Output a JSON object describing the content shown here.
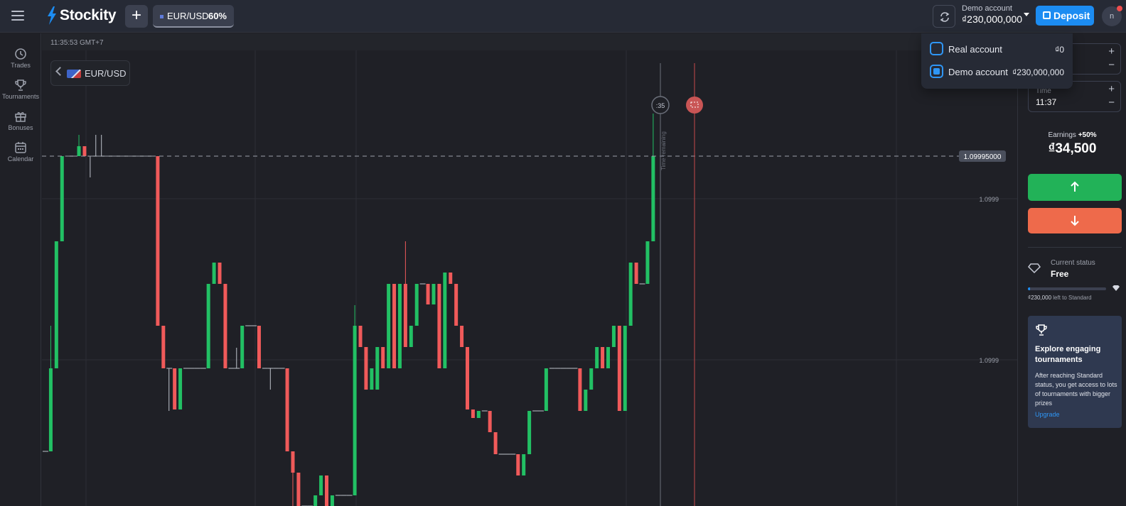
{
  "topbar": {
    "brand": "Stockity",
    "add_label": "+",
    "asset_tab": {
      "name": "EUR/USD",
      "payout": "60%"
    },
    "account": {
      "label": "Demo account",
      "balance": "₫230,000,000"
    },
    "deposit_label": "Deposit",
    "avatar_initial": "n"
  },
  "sidebar": {
    "items": [
      {
        "label": "Trades",
        "icon": "clock-icon"
      },
      {
        "label": "Tournaments",
        "icon": "trophy-icon"
      },
      {
        "label": "Bonuses",
        "icon": "gift-icon"
      },
      {
        "label": "Calendar",
        "icon": "calendar-icon"
      }
    ]
  },
  "chart": {
    "time": "11:35:53 GMT+7",
    "asset": "EUR/USD",
    "current_price": "1.09995000",
    "price_labels": [
      "1.0999",
      "1.0999"
    ],
    "countdown": ":35",
    "countdown_caption": "Time remaining",
    "colors": {
      "up": "#22c064",
      "down": "#f05a5a",
      "grid": "#2c2e35"
    }
  },
  "chart_data": {
    "type": "candlestick",
    "series": [
      {
        "name": "candles",
        "values": [
          [
            0,
            636,
            636,
            636,
            636
          ],
          [
            1,
            636,
            519,
            519,
            459
          ],
          [
            2,
            519,
            340,
            340,
            340
          ],
          [
            3,
            340,
            220,
            220,
            220
          ],
          [
            4,
            220,
            220,
            220,
            220
          ],
          [
            5,
            220,
            220,
            220,
            220
          ],
          [
            6,
            220,
            206,
            220,
            190
          ],
          [
            7,
            206,
            220,
            220,
            206
          ],
          [
            8,
            220,
            220,
            220,
            250
          ],
          [
            9,
            220,
            220,
            220,
            190
          ],
          [
            10,
            220,
            220,
            220,
            190
          ],
          [
            11,
            220,
            220,
            220,
            220
          ],
          [
            12,
            220,
            220,
            220,
            220
          ],
          [
            13,
            220,
            220,
            220,
            220
          ],
          [
            14,
            220,
            220,
            220,
            220
          ],
          [
            15,
            220,
            220,
            220,
            220
          ],
          [
            16,
            220,
            220,
            220,
            220
          ],
          [
            17,
            220,
            220,
            220,
            220
          ],
          [
            18,
            220,
            220,
            220,
            220
          ],
          [
            19,
            220,
            220,
            220,
            220
          ],
          [
            20,
            220,
            459,
            459,
            459
          ],
          [
            21,
            459,
            519,
            519,
            519
          ],
          [
            22,
            519,
            519,
            519,
            579
          ],
          [
            23,
            519,
            577,
            577,
            577
          ],
          [
            24,
            577,
            519,
            519,
            519
          ],
          [
            25,
            519,
            519,
            519,
            519
          ],
          [
            26,
            519,
            519,
            519,
            519
          ],
          [
            27,
            519,
            519,
            519,
            519
          ],
          [
            28,
            519,
            519,
            519,
            519
          ],
          [
            29,
            519,
            400,
            400,
            400
          ],
          [
            30,
            400,
            370,
            370,
            370
          ],
          [
            31,
            370,
            400,
            400,
            400
          ],
          [
            32,
            400,
            519,
            519,
            519
          ],
          [
            33,
            519,
            519,
            519,
            519
          ],
          [
            34,
            519,
            519,
            519,
            490
          ],
          [
            35,
            519,
            459,
            459,
            459
          ],
          [
            36,
            459,
            459,
            459,
            459
          ],
          [
            37,
            459,
            459,
            459,
            459
          ],
          [
            38,
            459,
            519,
            519,
            519
          ],
          [
            39,
            519,
            519,
            519,
            519
          ],
          [
            40,
            519,
            519,
            519,
            549
          ],
          [
            41,
            519,
            519,
            519,
            519
          ],
          [
            42,
            519,
            519,
            519,
            519
          ],
          [
            43,
            519,
            636,
            636,
            636
          ],
          [
            44,
            636,
            666,
            666,
            713
          ],
          [
            45,
            666,
            713,
            713,
            713
          ],
          [
            46,
            713,
            713,
            713,
            713
          ],
          [
            47,
            713,
            713,
            713,
            713
          ],
          [
            48,
            713,
            698,
            698,
            698
          ],
          [
            49,
            698,
            670,
            670,
            670
          ],
          [
            50,
            670,
            713,
            713,
            713
          ],
          [
            51,
            713,
            698,
            698,
            698
          ],
          [
            52,
            698,
            698,
            698,
            698
          ],
          [
            53,
            698,
            698,
            698,
            698
          ],
          [
            54,
            698,
            698,
            698,
            698
          ],
          [
            55,
            698,
            459,
            459,
            430
          ],
          [
            56,
            459,
            489,
            489,
            489
          ],
          [
            57,
            489,
            549,
            549,
            549
          ],
          [
            58,
            549,
            519,
            519,
            519
          ],
          [
            59,
            549,
            489,
            489,
            489
          ],
          [
            60,
            489,
            519,
            519,
            519
          ],
          [
            61,
            519,
            400,
            400,
            400
          ],
          [
            62,
            400,
            519,
            519,
            519
          ],
          [
            63,
            519,
            400,
            400,
            400
          ],
          [
            64,
            400,
            489,
            489,
            340
          ],
          [
            65,
            489,
            459,
            459,
            459
          ],
          [
            66,
            459,
            400,
            400,
            400
          ],
          [
            67,
            400,
            400,
            400,
            400
          ],
          [
            68,
            400,
            429,
            429,
            429
          ],
          [
            69,
            429,
            400,
            400,
            400
          ],
          [
            70,
            400,
            519,
            519,
            519
          ],
          [
            71,
            519,
            384,
            384,
            384
          ],
          [
            72,
            384,
            400,
            400,
            400
          ],
          [
            73,
            400,
            459,
            459,
            459
          ],
          [
            74,
            459,
            489,
            489,
            489
          ],
          [
            75,
            489,
            577,
            577,
            577
          ],
          [
            76,
            577,
            589,
            589,
            589
          ],
          [
            77,
            589,
            579,
            579,
            579
          ],
          [
            78,
            579,
            579,
            579,
            579
          ],
          [
            79,
            579,
            609,
            609,
            609
          ],
          [
            80,
            609,
            640,
            640,
            640
          ],
          [
            81,
            640,
            640,
            640,
            640
          ],
          [
            82,
            640,
            640,
            640,
            640
          ],
          [
            83,
            640,
            640,
            640,
            640
          ],
          [
            84,
            640,
            670,
            670,
            670
          ],
          [
            85,
            670,
            640,
            640,
            640
          ],
          [
            86,
            640,
            579,
            579,
            579
          ],
          [
            87,
            579,
            579,
            579,
            579
          ],
          [
            88,
            579,
            579,
            579,
            579
          ],
          [
            89,
            579,
            519,
            519,
            519
          ],
          [
            90,
            519,
            519,
            519,
            519
          ],
          [
            91,
            519,
            519,
            519,
            519
          ],
          [
            92,
            519,
            519,
            519,
            519
          ],
          [
            93,
            519,
            519,
            519,
            519
          ],
          [
            94,
            519,
            519,
            519,
            519
          ],
          [
            95,
            519,
            579,
            579,
            579
          ],
          [
            96,
            579,
            549,
            549,
            549
          ],
          [
            97,
            549,
            519,
            519,
            519
          ],
          [
            98,
            519,
            489,
            489,
            489
          ],
          [
            99,
            489,
            519,
            519,
            519
          ],
          [
            100,
            519,
            489,
            489,
            489
          ],
          [
            101,
            489,
            459,
            459,
            459
          ],
          [
            102,
            459,
            579,
            579,
            579
          ],
          [
            103,
            579,
            459,
            459,
            459
          ],
          [
            104,
            459,
            370,
            370,
            370
          ],
          [
            105,
            370,
            400,
            400,
            400
          ],
          [
            106,
            400,
            400,
            400,
            400
          ],
          [
            107,
            400,
            340,
            340,
            340
          ],
          [
            108,
            340,
            220,
            220,
            160
          ]
        ]
      }
    ]
  },
  "trade_panel": {
    "time_label": "Time",
    "time_value": "11:37",
    "earnings_label": "Earnings",
    "earnings_pct": "+50%",
    "earnings_value": "₫34,500"
  },
  "status": {
    "label": "Current status",
    "value": "Free",
    "progress": 0.03,
    "amount": "₫230,000",
    "caption": "left to Standard"
  },
  "promo": {
    "title": "Explore engaging tournaments",
    "text": "After reaching Standard status, you get access to lots of tournaments with bigger prizes",
    "link": "Upgrade"
  },
  "account_menu": {
    "options": [
      {
        "name": "Real account",
        "amount": "₫0",
        "selected": false
      },
      {
        "name": "Demo account",
        "amount": "₫230,000,000",
        "selected": true
      }
    ]
  }
}
